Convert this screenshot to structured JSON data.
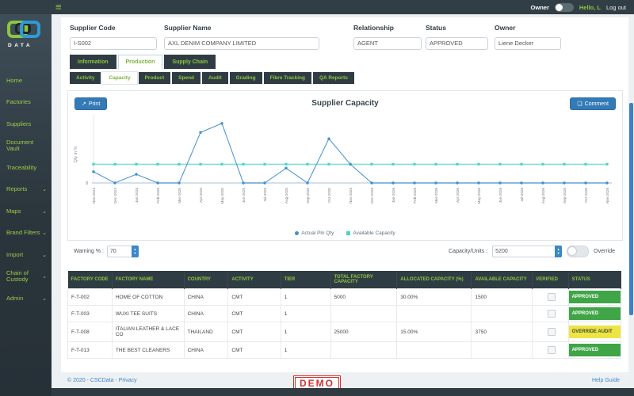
{
  "topbar": {
    "owner_label": "Owner",
    "greeting": "Hello, L",
    "logout": "Log out"
  },
  "logo": {
    "text": "DATA"
  },
  "sidebar": {
    "items": [
      {
        "label": "Home",
        "expandable": false
      },
      {
        "label": "Factories",
        "expandable": false
      },
      {
        "label": "Suppliers",
        "expandable": false
      },
      {
        "label": "Document Vault",
        "expandable": false
      },
      {
        "label": "Traceability",
        "expandable": false
      },
      {
        "label": "Reports",
        "expandable": true
      },
      {
        "label": "Maps",
        "expandable": true
      },
      {
        "label": "Brand Filters",
        "expandable": true
      },
      {
        "label": "Import",
        "expandable": true
      },
      {
        "label": "Chain of Custody",
        "expandable": true
      },
      {
        "label": "Admin",
        "expandable": true
      }
    ]
  },
  "header": {
    "fields": [
      {
        "label": "Supplier Code",
        "value": "I-S002"
      },
      {
        "label": "Supplier Name",
        "value": "AXL DENIM COMPANY LIMITED"
      },
      {
        "label": "Relationship",
        "value": "AGENT"
      },
      {
        "label": "Status",
        "value": "APPROVED"
      },
      {
        "label": "Owner",
        "value": "Liene Decker"
      }
    ]
  },
  "tabs": [
    {
      "label": "Information",
      "active": false
    },
    {
      "label": "Production",
      "active": true
    },
    {
      "label": "Supply Chain",
      "active": false
    }
  ],
  "subtabs": [
    {
      "label": "Activity",
      "active": false
    },
    {
      "label": "Capacity",
      "active": true
    },
    {
      "label": "Product",
      "active": false
    },
    {
      "label": "Spend",
      "active": false
    },
    {
      "label": "Audit",
      "active": false
    },
    {
      "label": "Grading",
      "active": false
    },
    {
      "label": "Fibre Tracking",
      "active": false
    },
    {
      "label": "QA Reports",
      "active": false
    }
  ],
  "chart_card": {
    "print_label": "Print",
    "print_icon": "↗",
    "comment_label": "Comment",
    "comment_icon": "❏",
    "title": "Supplier Capacity"
  },
  "chart_data": {
    "type": "line",
    "title": "Supplier Capacity",
    "xlabel": "",
    "ylabel": "Qty in %",
    "ylim": [
      0,
      18000
    ],
    "grid": false,
    "legend_position": "bottom",
    "categories": [
      "Nov-2024",
      "Dec-2024",
      "Jan-2025",
      "Feb-2025",
      "Mar-2025",
      "Apr-2025",
      "May-2025",
      "Jun-2025",
      "Jul-2025",
      "Aug-2025",
      "Sep-2025",
      "Oct-2025",
      "Nov-2025",
      "Dec-2025",
      "Jan-2026",
      "Feb-2026",
      "Mar-2026",
      "Apr-2026",
      "May-2026",
      "Jun-2026",
      "Jul-2026",
      "Aug-2026",
      "Sep-2026",
      "Oct-2026",
      "Nov-2026"
    ],
    "series": [
      {
        "name": "Actual Pln Qty",
        "color": "#3f8fd2",
        "marker": "circle",
        "values": [
          3100,
          0,
          2400,
          0,
          0,
          14000,
          16500,
          0,
          0,
          4100,
          0,
          12250,
          5200,
          0,
          0,
          0,
          0,
          0,
          0,
          0,
          0,
          0,
          0,
          0,
          0
        ]
      },
      {
        "name": "Available Capacity",
        "color": "#45d8c5",
        "marker": "square",
        "values": [
          5200,
          5200,
          5200,
          5200,
          5200,
          5200,
          5200,
          5200,
          5200,
          5200,
          5200,
          5200,
          5200,
          5200,
          5200,
          5200,
          5200,
          5200,
          5200,
          5200,
          5200,
          5200,
          5200,
          5200,
          5200
        ]
      }
    ]
  },
  "controls": {
    "warning_label": "Warning % :",
    "warning_value": "70",
    "capacity_label": "Capacity/Units :",
    "capacity_value": "5200",
    "override_label": "Override"
  },
  "table": {
    "headers": [
      "FACTORY CODE",
      "FACTORY NAME",
      "COUNTRY",
      "ACTIVITY",
      "TIER",
      "TOTAL FACTORY CAPACITY",
      "ALLOCATED CAPACITY (%)",
      "AVAILABLE CAPACITY",
      "VERIFIED",
      "STATUS"
    ],
    "rows": [
      {
        "code": "F-T-002",
        "name": "HOME OF COTTON",
        "country": "CHINA",
        "activity": "CMT",
        "tier": "1",
        "total": "5000",
        "allocated": "30.00%",
        "available": "1500",
        "verified": false,
        "status": "APPROVED",
        "status_class": "st-green"
      },
      {
        "code": "F-T-003",
        "name": "WUXI TEE SUITS",
        "country": "CHINA",
        "activity": "CMT",
        "tier": "1",
        "total": "",
        "allocated": "",
        "available": "",
        "verified": false,
        "status": "APPROVED",
        "status_class": "st-green"
      },
      {
        "code": "F-T-008",
        "name": "ITALIAN LEATHER & LACE CO",
        "country": "THAILAND",
        "activity": "CMT",
        "tier": "1",
        "total": "25000",
        "allocated": "15.00%",
        "available": "3750",
        "verified": false,
        "status": "OVERRIDE AUDIT",
        "status_class": "st-yellow"
      },
      {
        "code": "F-T-013",
        "name": "THE BEST CLEANERS",
        "country": "CHINA",
        "activity": "CMT",
        "tier": "1",
        "total": "",
        "allocated": "",
        "available": "",
        "verified": false,
        "status": "APPROVED",
        "status_class": "st-green"
      }
    ]
  },
  "footer": {
    "copyright": "© 2020 - CSCData -",
    "privacy": "Privacy",
    "demo": "DEMO",
    "help": "Help Guide"
  },
  "colors": {
    "accent_blue": "#337ab7",
    "sidebar_green": "#9ccc49",
    "status_green": "#3fa546",
    "status_yellow": "#ece543",
    "line_blue": "#3f8fd2",
    "line_teal": "#45d8c5"
  }
}
